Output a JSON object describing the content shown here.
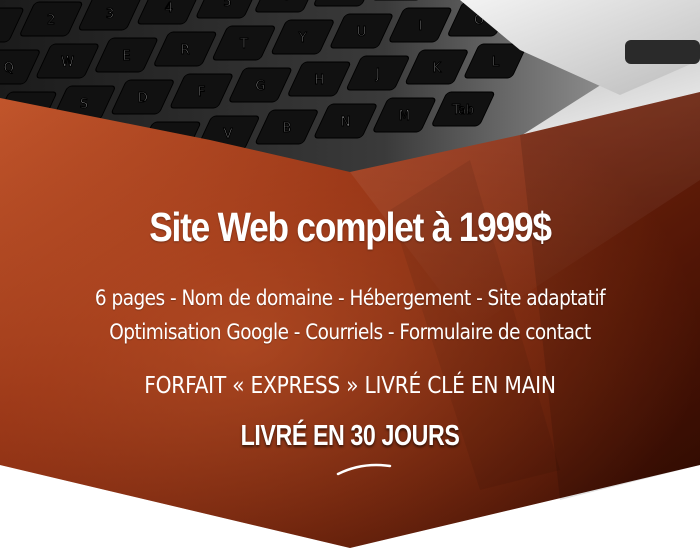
{
  "promo": {
    "headline": "Site Web complet à 1999$",
    "features_line1": "6 pages - Nom de domaine - Hébergement - Site adaptatif",
    "features_line2": "Optimisation Google - Courriels - Formulaire de contact",
    "package_label": "FORFAIT « EXPRESS » LIVRÉ CLÉ EN MAIN",
    "delivery_label": "LIVRÉ EN 30 JOURS"
  },
  "keyboard": {
    "keys": [
      "1",
      "2",
      "3",
      "4",
      "5",
      "6",
      "7",
      "8",
      "9",
      "Q",
      "W",
      "E",
      "R",
      "T",
      "Y",
      "U",
      "I",
      "O",
      "A",
      "S",
      "D",
      "F",
      "G",
      "H",
      "J",
      "K",
      "L",
      "Z",
      "X",
      "C",
      "V",
      "B",
      "N",
      "M",
      "Tab"
    ]
  },
  "colors": {
    "banner_dark": "#3a0c02",
    "banner_mid": "#7a2410",
    "banner_light": "#b84a24",
    "text": "#ffffff"
  }
}
